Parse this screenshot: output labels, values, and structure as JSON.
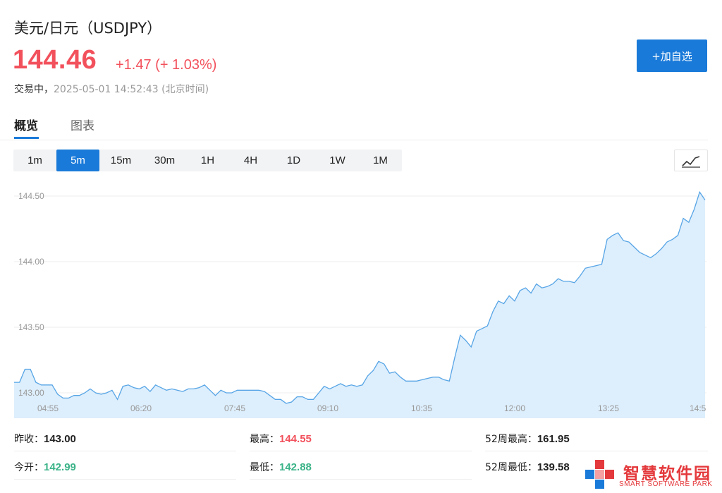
{
  "header": {
    "title": "美元/日元（USDJPY）",
    "price": "144.46",
    "change": "+1.47 (+ 1.03%)",
    "status": "交易中，",
    "timestamp": "2025-05-01 14:52:43 (北京时间)",
    "add_button_label": "+加自选"
  },
  "tabs": [
    {
      "label": "概览",
      "active": true
    },
    {
      "label": "图表",
      "active": false
    }
  ],
  "intervals": [
    {
      "label": "1m",
      "active": false
    },
    {
      "label": "5m",
      "active": true
    },
    {
      "label": "15m",
      "active": false
    },
    {
      "label": "30m",
      "active": false
    },
    {
      "label": "1H",
      "active": false
    },
    {
      "label": "4H",
      "active": false
    },
    {
      "label": "1D",
      "active": false
    },
    {
      "label": "1W",
      "active": false
    },
    {
      "label": "1M",
      "active": false
    }
  ],
  "chart_toggle_icon": "line-chart-icon",
  "chart_data": {
    "type": "area",
    "y_ticks": [
      "144.50",
      "144.00",
      "143.50",
      "143.00"
    ],
    "x_ticks": [
      "04:55",
      "06:20",
      "07:45",
      "09:10",
      "10:35",
      "12:00",
      "13:25",
      "14:5"
    ],
    "ylim": [
      142.88,
      144.58
    ],
    "grid": true,
    "line_color": "#57a5e6",
    "fill_color": "#ddeefc",
    "series": [
      {
        "values": [
          143.08,
          143.08,
          143.18,
          143.18,
          143.08,
          143.06,
          143.06,
          143.06,
          142.99,
          142.96,
          142.96,
          142.98,
          142.98,
          143.0,
          143.03,
          143.0,
          142.99,
          143.0,
          143.02,
          142.95,
          143.05,
          143.06,
          143.04,
          143.03,
          143.05,
          143.01,
          143.06,
          143.04,
          143.02,
          143.03,
          143.02,
          143.01,
          143.03,
          143.03,
          143.04,
          143.06,
          143.02,
          142.98,
          143.02,
          143.0,
          143.0,
          143.02,
          143.02,
          143.02,
          143.02,
          143.02,
          143.01,
          142.98,
          142.95,
          142.95,
          142.92,
          142.93,
          142.97,
          142.97,
          142.95,
          142.95,
          143.0,
          143.05,
          143.03,
          143.05,
          143.07,
          143.05,
          143.06,
          143.05,
          143.06,
          143.13,
          143.17,
          143.24,
          143.22,
          143.15,
          143.16,
          143.12,
          143.09,
          143.09,
          143.09,
          143.1,
          143.11,
          143.12,
          143.12,
          143.1,
          143.09,
          143.27,
          143.44,
          143.4,
          143.35,
          143.47,
          143.49,
          143.51,
          143.62,
          143.7,
          143.68,
          143.74,
          143.7,
          143.78,
          143.8,
          143.76,
          143.83,
          143.8,
          143.81,
          143.83,
          143.87,
          143.85,
          143.85,
          143.84,
          143.89,
          143.95,
          143.96,
          143.97,
          143.98,
          144.17,
          144.2,
          144.22,
          144.16,
          144.15,
          144.11,
          144.07,
          144.05,
          144.03,
          144.06,
          144.1,
          144.15,
          144.17,
          144.2,
          144.33,
          144.3,
          144.4,
          144.53,
          144.47
        ]
      }
    ]
  },
  "stats": [
    {
      "label": "昨收：",
      "value": "143.00",
      "tone": "neutral"
    },
    {
      "label": "最高：",
      "value": "144.55",
      "tone": "red"
    },
    {
      "label": "52周最高：",
      "value": "161.95",
      "tone": "neutral"
    },
    {
      "label": "今开：",
      "value": "142.99",
      "tone": "green"
    },
    {
      "label": "最低：",
      "value": "142.88",
      "tone": "green"
    },
    {
      "label": "52周最低：",
      "value": "139.58",
      "tone": "neutral"
    }
  ],
  "watermark": {
    "text": "智慧软件园",
    "subtext": "SMART SOFTWARE PARK"
  },
  "colors": {
    "up": "#f2515c",
    "down": "#3bb388",
    "accent": "#1a7ad9"
  }
}
